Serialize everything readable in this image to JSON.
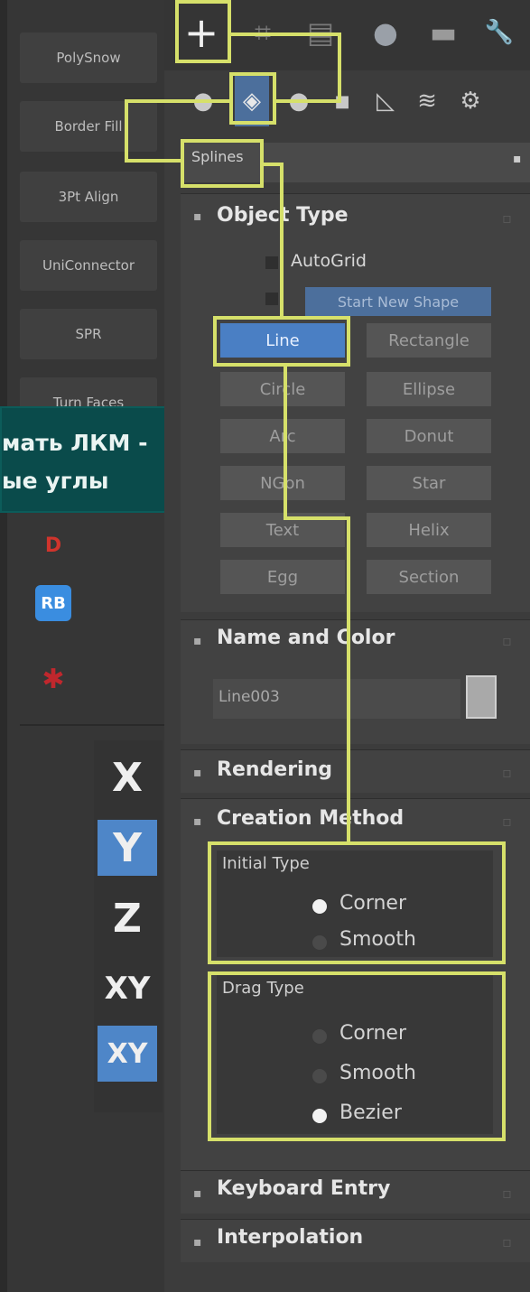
{
  "left_panel": {
    "scripts": [
      "PolySnow",
      "Border Fill",
      "3Pt Align",
      "UniConnector",
      "SPR",
      "Turn Faces"
    ],
    "app_icons": [
      {
        "name": "red-d-icon",
        "glyph": "D",
        "color": "#d0342c"
      },
      {
        "name": "rb-icon",
        "glyph": "RB",
        "color": "#3a8de0"
      },
      {
        "name": "bug-icon",
        "glyph": "✱",
        "color": "#c0272d"
      }
    ]
  },
  "tooltip": {
    "line1": "мать ЛКМ -",
    "line2": "ые углы",
    "bg": "#0a4b4b"
  },
  "axis_constraints": [
    "X",
    "Y",
    "Z",
    "XY",
    "XY"
  ],
  "command_panel": {
    "tabs": [
      {
        "icon": "create-plus-icon",
        "glyph": "+"
      },
      {
        "icon": "modify-icon",
        "glyph": "⌗"
      },
      {
        "icon": "hierarchy-icon",
        "glyph": "▤"
      },
      {
        "icon": "motion-icon",
        "glyph": "●"
      },
      {
        "icon": "display-icon",
        "glyph": "▬"
      },
      {
        "icon": "utilities-icon",
        "glyph": "🔧"
      }
    ],
    "sub_icons": [
      {
        "icon": "geometry-icon",
        "glyph": "●"
      },
      {
        "icon": "shapes-icon",
        "glyph": "◈"
      },
      {
        "icon": "lights-icon",
        "glyph": "●"
      },
      {
        "icon": "cameras-icon",
        "glyph": "■"
      },
      {
        "icon": "helpers-icon",
        "glyph": "◺"
      },
      {
        "icon": "spacewarps-icon",
        "glyph": "≋"
      },
      {
        "icon": "systems-icon",
        "glyph": "⚙"
      }
    ],
    "category_dropdown": "Splines",
    "object_type": {
      "title": "Object Type",
      "autogrid_label": "AutoGrid",
      "start_new_shape_label": "Start New Shape",
      "buttons": [
        [
          "Line",
          "Rectangle"
        ],
        [
          "Circle",
          "Ellipse"
        ],
        [
          "Arc",
          "Donut"
        ],
        [
          "NGon",
          "Star"
        ],
        [
          "Text",
          "Helix"
        ],
        [
          "Egg",
          "Section"
        ]
      ],
      "active_button": "Line"
    },
    "name_and_color": {
      "title": "Name and Color",
      "name_value": "Line003",
      "swatch_color": "#a9a9a9"
    },
    "rendering": {
      "title": "Rendering"
    },
    "creation_method": {
      "title": "Creation Method",
      "initial_type": {
        "label": "Initial Type",
        "options": [
          "Corner",
          "Smooth"
        ],
        "selected": "Corner"
      },
      "drag_type": {
        "label": "Drag Type",
        "options": [
          "Corner",
          "Smooth",
          "Bezier"
        ],
        "selected": "Bezier"
      }
    },
    "keyboard_entry": {
      "title": "Keyboard Entry"
    },
    "interpolation": {
      "title": "Interpolation"
    }
  },
  "colors": {
    "highlight": "#d6e06a",
    "active_blue": "#4a7fc4"
  }
}
